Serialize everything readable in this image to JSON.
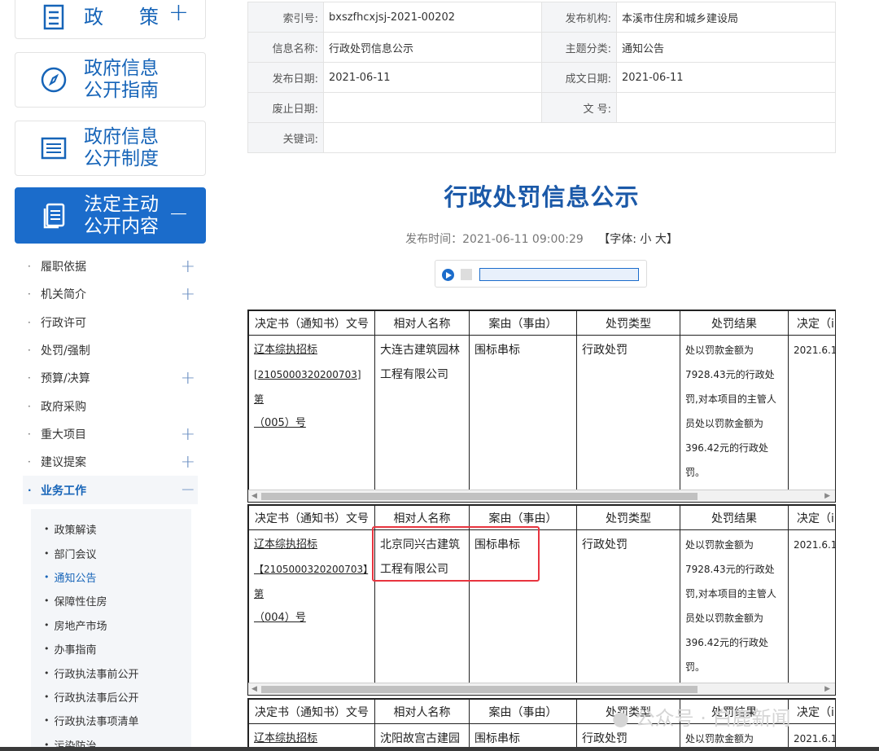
{
  "sidebar": {
    "cards": [
      {
        "title": "政　策",
        "icon": "policy-icon",
        "pm": "+"
      },
      {
        "title": "政府信息公开指南",
        "icon": "compass-icon"
      },
      {
        "title": "政府信息公开制度",
        "icon": "list-icon"
      },
      {
        "title": "法定主动公开内容",
        "icon": "document-icon",
        "pm": "−"
      }
    ],
    "menu": [
      {
        "label": "履职依据",
        "pm": "+"
      },
      {
        "label": "机关简介",
        "pm": "+"
      },
      {
        "label": "行政许可",
        "pm": ""
      },
      {
        "label": "处罚/强制",
        "pm": ""
      },
      {
        "label": "预算/决算",
        "pm": "+"
      },
      {
        "label": "政府采购",
        "pm": ""
      },
      {
        "label": "重大项目",
        "pm": "+"
      },
      {
        "label": "建议提案",
        "pm": "+"
      },
      {
        "label": "业务工作",
        "pm": "−"
      }
    ],
    "submenu": [
      "政策解读",
      "部门会议",
      "通知公告",
      "保障性住房",
      "房地产市场",
      "办事指南",
      "行政执法事前公开",
      "行政执法事后公开",
      "行政执法事项清单",
      "污染防治"
    ]
  },
  "meta": {
    "index_label": "索引号:",
    "index_value": "bxszfhcxjsj-2021-00202",
    "org_label": "发布机构:",
    "org_value": "本溪市住房和城乡建设局",
    "name_label": "信息名称:",
    "name_value": "行政处罚信息公示",
    "topic_label": "主题分类:",
    "topic_value": "通知公告",
    "pubdate_label": "发布日期:",
    "pubdate_value": "2021-06-11",
    "madedate_label": "成文日期:",
    "madedate_value": "2021-06-11",
    "abolish_label": "废止日期:",
    "abolish_value": "",
    "docno_label": "文 号:",
    "docno_value": "",
    "keywords_label": "关键词:",
    "keywords_value": ""
  },
  "article": {
    "title": "行政处罚信息公示",
    "pub_time": "发布时间：2021-06-11 09:00:29",
    "font_size_label": "【字体: 小 大】"
  },
  "penalty_headers": [
    "决定书（通知书）文号",
    "相对人名称",
    "案由（事由）",
    "处罚类型",
    "处罚结果",
    "决定（i"
  ],
  "penalties": [
    {
      "doc_l1": "辽本综执招标",
      "doc_l2": "[2105000320200703]第",
      "doc_l3": "（005）号",
      "party": "大连古建筑园林工程有限公司",
      "reason": "围标串标",
      "type": "行政处罚",
      "result": "处以罚款金额为7928.43元的行政处罚,对本项目的主管人员处以罚款金额为396.42元的行政处罚。",
      "date": "2021.6.1("
    },
    {
      "doc_l1": "辽本综执招标",
      "doc_l2": "【2105000320200703】第",
      "doc_l3": "（004）号",
      "party": "北京同兴古建筑工程有限公司",
      "reason": "围标串标",
      "type": "行政处罚",
      "result": "处以罚款金额为7928.43元的行政处罚,对本项目的主管人员处以罚款金额为396.42元的行政处罚。",
      "date": "2021.6.1("
    },
    {
      "doc_l1": "辽本综执招标",
      "party": "沈阳故宫古建园",
      "reason": "围标串标",
      "type": "行政处罚",
      "result": "处以罚款金额为",
      "date": "2021.6.1("
    }
  ],
  "watermark": "公众号 · 白鹿新闻"
}
